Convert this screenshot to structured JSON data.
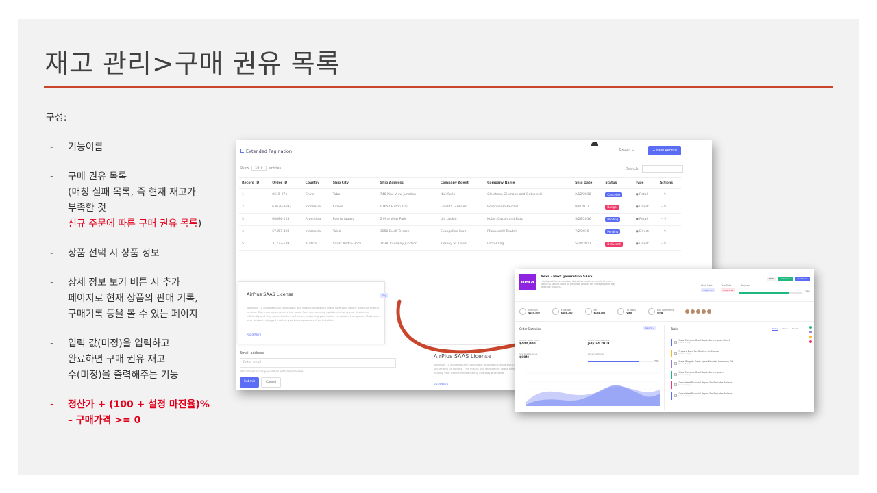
{
  "slide": {
    "title": "재고 관리>구매 권유 목록",
    "composition_label": "구성:",
    "bullets": [
      {
        "dash": "-",
        "lines": [
          "기능이름"
        ]
      },
      {
        "dash": "-",
        "lines": [
          "구매 권유 목록",
          "(매칭 실패 목록, 즉 현재 재고가",
          "부족한 것"
        ],
        "red_line": "신규 주문에 따른 구매 권유 목록",
        "red_tail": ")"
      },
      {
        "dash": "-",
        "lines": [
          "상품 선택 시 상품 정보"
        ]
      },
      {
        "dash": "-",
        "lines": [
          "상세 정보 보기 버튼 시 추가",
          "페이지로 현재 상품의 판매 기록,",
          "구매기록 등을 볼 수 있는 페이지"
        ]
      },
      {
        "dash": "-",
        "lines": [
          "입력 값(미정)을 입력하고",
          "완료하면 구매 권유 재고",
          "수(미정)을 출력해주는 기능"
        ]
      },
      {
        "dash": "-",
        "lines": [
          "정산가 + (100 + 설정 마진율)%",
          "– 구매가격 >= 0"
        ]
      }
    ],
    "accent_color": "#c9452b",
    "red_color": "#e0001b"
  },
  "shot1": {
    "header_title": "Extended Pagination",
    "export_label": "Export ⌄",
    "new_record_label": "+ New Record",
    "show_label": "Show",
    "show_value": "10 ⬍",
    "entries_label": "entries",
    "search_label": "Search:",
    "columns": [
      "Record ID",
      "Order ID",
      "Country",
      "Ship City",
      "Ship Address",
      "Company Agent",
      "Company Name",
      "Ship Date",
      "Status",
      "Type",
      "Actions"
    ],
    "rows": [
      {
        "id": "1",
        "order": "0615-071",
        "country": "China",
        "city": "Tobo",
        "address": "746 Pine View Junction",
        "agent": "Nixi Sailo",
        "company": "Gleichner, Ziemann and Gutkowski",
        "date": "2/12/2018",
        "status": "Canceled",
        "status_color": "#5b6cf5",
        "type": "● Retail",
        "actions": "⋯ ✎"
      },
      {
        "id": "2",
        "order": "63629-4697",
        "country": "Indonesia",
        "city": "Cihaur",
        "address": "01652 Fulton Trail",
        "agent": "Emelita Giraldez",
        "company": "Rosenbaum-Reichel",
        "date": "8/6/2017",
        "status": "Danger",
        "status_color": "#ef3a6a",
        "type": "● Direct",
        "actions": "⋯ ✎"
      },
      {
        "id": "3",
        "order": "68084-123",
        "country": "Argentina",
        "city": "Puerto Iguazú",
        "address": "2 Pine View Park",
        "agent": "Ula Luckin",
        "company": "Kulas, Cassin and Batz",
        "date": "5/26/2016",
        "status": "Pending",
        "status_color": "#5b6cf5",
        "type": "● Retail",
        "actions": "⋯ ✎"
      },
      {
        "id": "4",
        "order": "67457-428",
        "country": "Indonesia",
        "city": "Talok",
        "address": "3050 Buell Terrace",
        "agent": "Evangeline Cure",
        "company": "Pfannerstill-Treutel",
        "date": "7/2/2016",
        "status": "Pending",
        "status_color": "#5b6cf5",
        "type": "● Direct",
        "actions": "⋯ ✎"
      },
      {
        "id": "5",
        "order": "31722-529",
        "country": "Austria",
        "city": "Sankt Andrä-Höch",
        "address": "3038 Trailsway Junction",
        "agent": "Tierney St. Louis",
        "company": "Dicki-Kling",
        "date": "5/20/2017",
        "status": "Delivered",
        "status_color": "#ef3a6a",
        "type": "● Direct",
        "actions": "⋯ ✎"
      }
    ],
    "card_title": "AirPlus SAAS License",
    "card_pill": "Pay",
    "card_body": "Windows 10 automatically downloads and installs updates to make sure your device is secure and up to date. This means you receive the latest fixes and security updates, helping your device run efficiently and stay protected. In most cases, restarting your device completes the update. Make sure your device is plugged in when you know updates will be installed.",
    "card_more": "Read More",
    "card2_title": "AirPlus SAAS License",
    "card2_body": "Windows 10 automatically downloads and installs updates to make sure your device is secure and up to date. This means you receive the latest fixes and security updates, helping your device run efficiently and stay protected.",
    "card2_more": "Read More",
    "form_label": "Email address",
    "form_placeholder": "Enter email",
    "form_hint": "We'll never share your email with anyone else.",
    "submit_label": "Submit",
    "cancel_label": "Cancel",
    "accent": "#5b6cf5"
  },
  "shot2": {
    "logo": "nexa",
    "title": "Nexa - Next generation SAAS",
    "desc": "I distinguish three main text objectives could be: merely to inform people. A second could be persuade people. You want people to bay objective products.",
    "buttons": [
      {
        "label": "Edit",
        "color": "#f0f0f0",
        "text": "#333"
      },
      {
        "label": "Add User",
        "color": "#1fb980",
        "text": "#fff"
      },
      {
        "label": "Add User",
        "color": "#5b6cf5",
        "text": "#fff"
      }
    ],
    "start_label": "Start Date",
    "start_value": "14 Jan, 16",
    "due_label": "Due Date",
    "due_value": "20 Jan, 19",
    "progress_label": "Progress",
    "progress_value": "78%",
    "progress_fraction": 0.78,
    "stats": [
      {
        "label": "Earnings",
        "value": "$249,500"
      },
      {
        "label": "Expenses",
        "value": "$164,700"
      },
      {
        "label": "Net",
        "value": "$184,500"
      },
      {
        "label": "73 Tasks",
        "value": "View"
      },
      {
        "label": "648 Comments",
        "value": "View"
      }
    ],
    "order_title": "Order Statistics",
    "report_label": "Report ⌄",
    "annual_label": "Annual Taxes 2018",
    "annual_value": "$400,000",
    "finance_label": "Finance Review Date",
    "finance_value": "July 24,2019",
    "avg_label": "Average Revenue",
    "avg_value": "$60M",
    "revenue_label": "Revenue Margin",
    "revenue_value": "78%",
    "revenue_fraction": 0.78,
    "tasks_title": "Tasks",
    "tabs": [
      "Today",
      "Week",
      "Month"
    ],
    "tasks": [
      {
        "text": "Make Metronic Great Again.Lorem Ipsum Amet",
        "sub": "Due in 2 Days",
        "color": "#5b6cf5"
      },
      {
        "text": "Prepare Docs For Meeting On Monday",
        "sub": "Due in 3 Days",
        "color": "#ffb822"
      },
      {
        "text": "Make Widgets Great Again.Estudiat Communy Elit",
        "sub": "Due in 5 Days",
        "color": "#9b7de0"
      },
      {
        "text": "Make Metronic Great Again.Lorem Ipsum",
        "sub": "Due in 2 Days",
        "color": "#1fb980"
      },
      {
        "text": "Completed Financial Report For Emirates Airlines",
        "sub": "Due in 2 Days",
        "color": "#ef3a6a"
      },
      {
        "text": "Completed Financial Report For Emirates Airlines",
        "sub": "Due in 2 Days",
        "color": "#5b6cf5"
      }
    ]
  }
}
